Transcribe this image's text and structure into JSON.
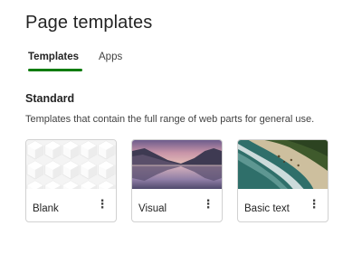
{
  "header": {
    "title": "Page templates"
  },
  "tabs": [
    {
      "label": "Templates",
      "selected": true
    },
    {
      "label": "Apps",
      "selected": false
    }
  ],
  "accent_color": "#107c10",
  "section": {
    "title": "Standard",
    "description": "Templates that contain the full range of web parts for general use."
  },
  "templates": [
    {
      "label": "Blank",
      "thumbnail": "white-geometric-pattern",
      "menu_icon": "more-vertical-icon"
    },
    {
      "label": "Visual",
      "thumbnail": "lake-mountain-sunset",
      "menu_icon": "more-vertical-icon"
    },
    {
      "label": "Basic text",
      "thumbnail": "aerial-beach",
      "menu_icon": "more-vertical-icon"
    }
  ]
}
